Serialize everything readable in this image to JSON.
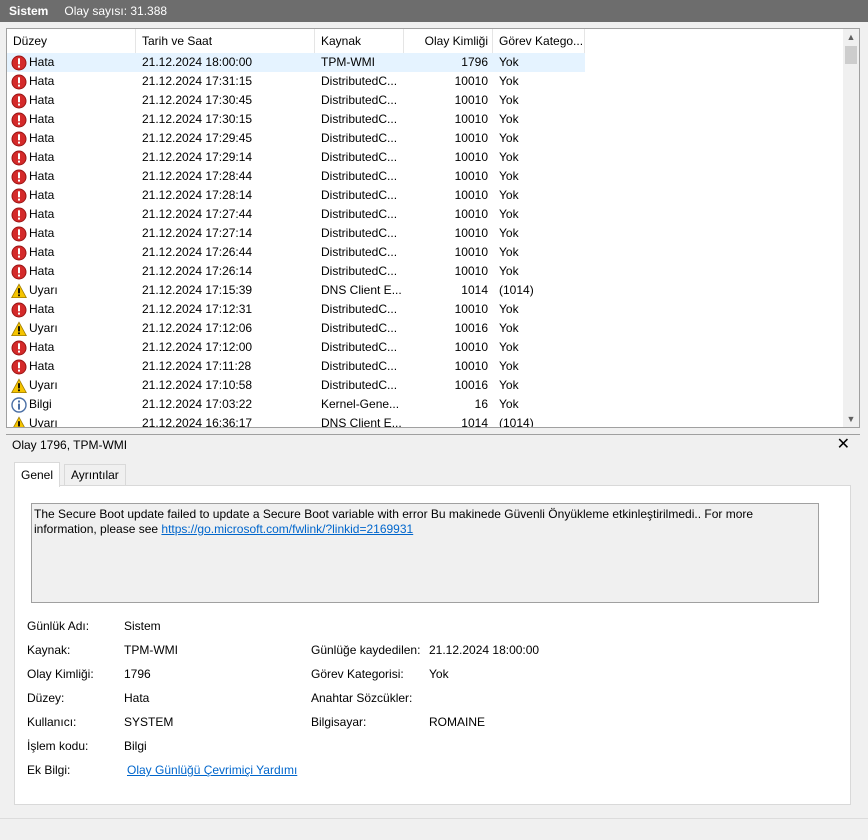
{
  "title": {
    "name": "Sistem",
    "count": "Olay sayısı: 31.388"
  },
  "columns": [
    "Düzey",
    "Tarih ve Saat",
    "Kaynak",
    "Olay Kimliği",
    "Görev Katego..."
  ],
  "rows": [
    {
      "level": "Hata",
      "type": "error",
      "date": "21.12.2024 18:00:00",
      "source": "TPM-WMI",
      "id": "1796",
      "category": "Yok"
    },
    {
      "level": "Hata",
      "type": "error",
      "date": "21.12.2024 17:31:15",
      "source": "DistributedC...",
      "id": "10010",
      "category": "Yok"
    },
    {
      "level": "Hata",
      "type": "error",
      "date": "21.12.2024 17:30:45",
      "source": "DistributedC...",
      "id": "10010",
      "category": "Yok"
    },
    {
      "level": "Hata",
      "type": "error",
      "date": "21.12.2024 17:30:15",
      "source": "DistributedC...",
      "id": "10010",
      "category": "Yok"
    },
    {
      "level": "Hata",
      "type": "error",
      "date": "21.12.2024 17:29:45",
      "source": "DistributedC...",
      "id": "10010",
      "category": "Yok"
    },
    {
      "level": "Hata",
      "type": "error",
      "date": "21.12.2024 17:29:14",
      "source": "DistributedC...",
      "id": "10010",
      "category": "Yok"
    },
    {
      "level": "Hata",
      "type": "error",
      "date": "21.12.2024 17:28:44",
      "source": "DistributedC...",
      "id": "10010",
      "category": "Yok"
    },
    {
      "level": "Hata",
      "type": "error",
      "date": "21.12.2024 17:28:14",
      "source": "DistributedC...",
      "id": "10010",
      "category": "Yok"
    },
    {
      "level": "Hata",
      "type": "error",
      "date": "21.12.2024 17:27:44",
      "source": "DistributedC...",
      "id": "10010",
      "category": "Yok"
    },
    {
      "level": "Hata",
      "type": "error",
      "date": "21.12.2024 17:27:14",
      "source": "DistributedC...",
      "id": "10010",
      "category": "Yok"
    },
    {
      "level": "Hata",
      "type": "error",
      "date": "21.12.2024 17:26:44",
      "source": "DistributedC...",
      "id": "10010",
      "category": "Yok"
    },
    {
      "level": "Hata",
      "type": "error",
      "date": "21.12.2024 17:26:14",
      "source": "DistributedC...",
      "id": "10010",
      "category": "Yok"
    },
    {
      "level": "Uyarı",
      "type": "warning",
      "date": "21.12.2024 17:15:39",
      "source": "DNS Client E...",
      "id": "1014",
      "category": "(1014)"
    },
    {
      "level": "Hata",
      "type": "error",
      "date": "21.12.2024 17:12:31",
      "source": "DistributedC...",
      "id": "10010",
      "category": "Yok"
    },
    {
      "level": "Uyarı",
      "type": "warning",
      "date": "21.12.2024 17:12:06",
      "source": "DistributedC...",
      "id": "10016",
      "category": "Yok"
    },
    {
      "level": "Hata",
      "type": "error",
      "date": "21.12.2024 17:12:00",
      "source": "DistributedC...",
      "id": "10010",
      "category": "Yok"
    },
    {
      "level": "Hata",
      "type": "error",
      "date": "21.12.2024 17:11:28",
      "source": "DistributedC...",
      "id": "10010",
      "category": "Yok"
    },
    {
      "level": "Uyarı",
      "type": "warning",
      "date": "21.12.2024 17:10:58",
      "source": "DistributedC...",
      "id": "10016",
      "category": "Yok"
    },
    {
      "level": "Bilgi",
      "type": "info",
      "date": "21.12.2024 17:03:22",
      "source": "Kernel-Gene...",
      "id": "16",
      "category": "Yok"
    },
    {
      "level": "Uyarı",
      "type": "warning",
      "date": "21.12.2024 16:36:17",
      "source": "DNS Client E...",
      "id": "1014",
      "category": "(1014)"
    }
  ],
  "detail": {
    "header": "Olay 1796, TPM-WMI",
    "tabs": [
      "Genel",
      "Ayrıntılar"
    ],
    "description": "The Secure Boot update failed to update a Secure Boot variable with error Bu makinede Güvenli Önyükleme etkinleştirilmedi.. For more information, please see ",
    "link": "https://go.microsoft.com/fwlink/?linkid=2169931",
    "fields": {
      "log_name_label": "Günlük Adı:",
      "log_name": "Sistem",
      "source_label": "Kaynak:",
      "source": "TPM-WMI",
      "event_id_label": "Olay Kimliği:",
      "event_id": "1796",
      "level_label": "Düzey:",
      "level": "Hata",
      "user_label": "Kullanıcı:",
      "user": "SYSTEM",
      "opcode_label": "İşlem kodu:",
      "opcode": "Bilgi",
      "more_info_label": "Ek Bilgi:",
      "more_info_link": "Olay Günlüğü Çevrimiçi Yardımı",
      "logged_label": "Günlüğe kaydedilen:",
      "logged": "21.12.2024 18:00:00",
      "task_cat_label": "Görev Kategorisi:",
      "task_cat": "Yok",
      "keywords_label": "Anahtar Sözcükler:",
      "computer_label": "Bilgisayar:",
      "computer": "ROMAINE"
    }
  },
  "colors": {
    "error": "#d42a2a",
    "warning": "#f5c400",
    "info": "#4a6fa5",
    "link": "#0066cc",
    "selection": "#e5f3ff"
  }
}
